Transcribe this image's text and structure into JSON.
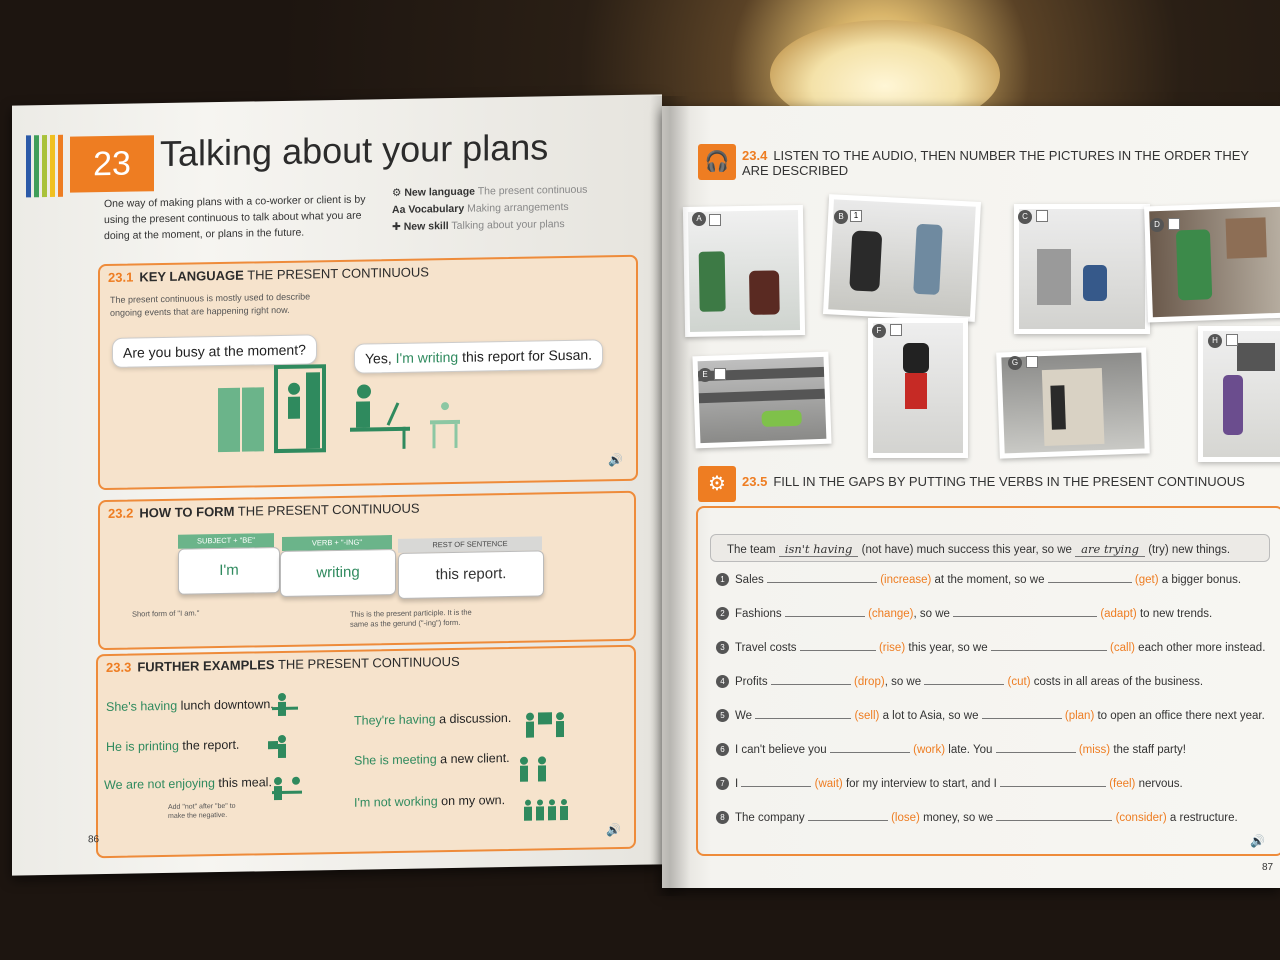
{
  "left_page": {
    "unit_number": "23",
    "title": "Talking about your plans",
    "intro": "One way of making plans with a co-worker or client is by using the present continuous to talk about what you are doing at the moment, or plans in the future.",
    "meta": [
      {
        "key": "New language",
        "value": "The present continuous"
      },
      {
        "key": "Vocabulary",
        "value": "Making arrangements"
      },
      {
        "key": "New skill",
        "value": "Talking about your plans"
      }
    ],
    "s1": {
      "num": "23.1",
      "head_bold": "KEY LANGUAGE",
      "head_rest": "THE PRESENT CONTINUOUS",
      "desc": "The present continuous is mostly used to describe ongoing events that are happening right now.",
      "bubble_q": "Are you busy at the moment?",
      "bubble_a_pre": "Yes, ",
      "bubble_a_green": "I'm writing",
      "bubble_a_post": " this report for Susan."
    },
    "s2": {
      "num": "23.2",
      "head_bold": "HOW TO FORM",
      "head_rest": "THE PRESENT CONTINUOUS",
      "cap1": "SUBJECT + \"BE\"",
      "cap2": "VERB + \"-ING\"",
      "cap3": "REST OF SENTENCE",
      "p1": "I'm",
      "p2": "writing",
      "p3": "this report.",
      "note1": "Short form of \"I am.\"",
      "note2": "This is the present participle. It is the same as the gerund (\"-ing\") form."
    },
    "s3": {
      "num": "23.3",
      "head_bold": "FURTHER EXAMPLES",
      "head_rest": "THE PRESENT CONTINUOUS",
      "ex1_g": "She's having",
      "ex1_r": " lunch downtown.",
      "ex2_g": "He is printing",
      "ex2_r": " the report.",
      "ex3_g": "We are not enjoying",
      "ex3_r": " this meal.",
      "ex4_g": "They're having",
      "ex4_r": " a discussion.",
      "ex5_g": "She is meeting",
      "ex5_r": " a new client.",
      "ex6_g": "I'm not working",
      "ex6_r": " on my own.",
      "note": "Add \"not\" after \"be\" to make the negative."
    },
    "page_number": "86"
  },
  "right_page": {
    "s4": {
      "num": "23.4",
      "head": "LISTEN TO THE AUDIO, THEN NUMBER THE PICTURES IN THE ORDER THEY ARE DESCRIBED",
      "labels": [
        "A",
        "B",
        "C",
        "D",
        "E",
        "F",
        "G",
        "H"
      ],
      "b_value": "1"
    },
    "s5": {
      "num": "23.5",
      "head": "FILL IN THE GAPS BY PUTTING THE VERBS IN THE PRESENT CONTINUOUS",
      "sample": {
        "a": "The team",
        "ans1": "isn't having",
        "h1": "(not have)",
        "b": "much success this year, so we",
        "ans2": "are trying",
        "h2": "(try)",
        "c": "new things."
      },
      "items": [
        {
          "n": "1",
          "a": "Sales",
          "h1": "(increase)",
          "b": "at the moment, so we",
          "h2": "(get)",
          "c": "a bigger bonus."
        },
        {
          "n": "2",
          "a": "Fashions",
          "h1": "(change)",
          "b": ", so we",
          "h2": "(adapt)",
          "c": "to new trends."
        },
        {
          "n": "3",
          "a": "Travel costs",
          "h1": "(rise)",
          "b": "this year, so we",
          "h2": "(call)",
          "c": "each other more instead."
        },
        {
          "n": "4",
          "a": "Profits",
          "h1": "(drop)",
          "b": ", so we",
          "h2": "(cut)",
          "c": "costs in all areas of the business."
        },
        {
          "n": "5",
          "a": "We",
          "h1": "(sell)",
          "b": "a lot to Asia, so we",
          "h2": "(plan)",
          "c": "to open an office there next year."
        },
        {
          "n": "6",
          "a": "I can't believe you",
          "h1": "(work)",
          "b": "late. You",
          "h2": "(miss)",
          "c": "the staff party!"
        },
        {
          "n": "7",
          "a": "I",
          "h1": "(wait)",
          "b": "for my interview to start, and I",
          "h2": "(feel)",
          "c": "nervous."
        },
        {
          "n": "8",
          "a": "The company",
          "h1": "(lose)",
          "b": "money, so we",
          "h2": "(consider)",
          "c": "a restructure."
        }
      ]
    },
    "page_number": "87"
  },
  "colors": {
    "orange": "#ee7d22",
    "green": "#2f8a5e",
    "panel": "#f6e3cc"
  }
}
